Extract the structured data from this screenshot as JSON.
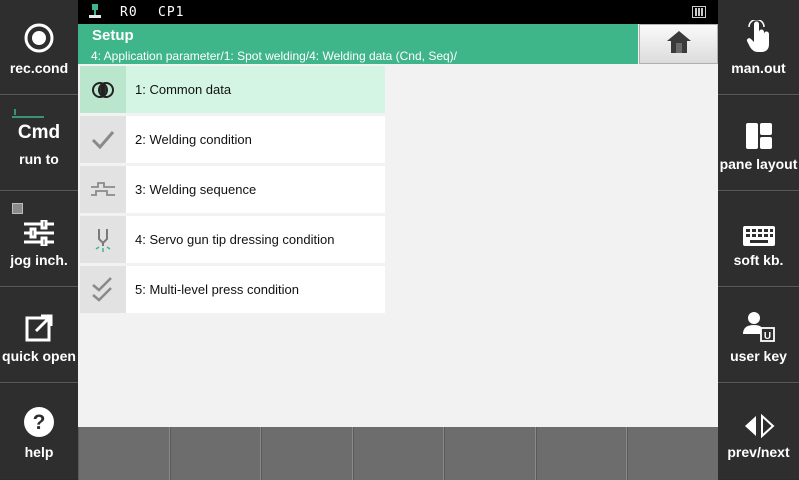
{
  "left_panel": [
    {
      "label": "rec.cond",
      "icon": "record-icon"
    },
    {
      "label": "run to",
      "top_text": "Cmd",
      "icon": "cmd-icon"
    },
    {
      "label": "jog inch.",
      "icon": "sliders-icon"
    },
    {
      "label": "quick open",
      "icon": "external-link-icon"
    },
    {
      "label": "help",
      "icon": "question-icon"
    }
  ],
  "right_panel": [
    {
      "label": "man.out",
      "icon": "hand-pointer-icon"
    },
    {
      "label": "pane layout",
      "icon": "pane-layout-icon"
    },
    {
      "label": "soft kb.",
      "icon": "keyboard-icon"
    },
    {
      "label": "user key",
      "icon": "user-key-icon"
    },
    {
      "label": "prev/next",
      "icon": "prev-next-icon"
    }
  ],
  "status_bar": {
    "robot": "R0",
    "program": "CP1"
  },
  "header": {
    "title": "Setup",
    "breadcrumb": "4: Application parameter/1: Spot welding/4: Welding data (Cnd, Seq)/"
  },
  "menu": [
    {
      "label": "1: Common data",
      "icon": "overlap-circles-icon",
      "selected": true
    },
    {
      "label": "2: Welding condition",
      "icon": "checkmark-icon",
      "selected": false
    },
    {
      "label": "3: Welding sequence",
      "icon": "sequence-pulse-icon",
      "selected": false
    },
    {
      "label": "4: Servo gun tip dressing condition",
      "icon": "gun-tip-icon",
      "selected": false
    },
    {
      "label": "5: Multi-level press condition",
      "icon": "double-check-icon",
      "selected": false
    }
  ],
  "colors": {
    "header": "#3fb58a",
    "selected_row": "#d4f5e4",
    "sidebar": "#2e2e2e"
  }
}
